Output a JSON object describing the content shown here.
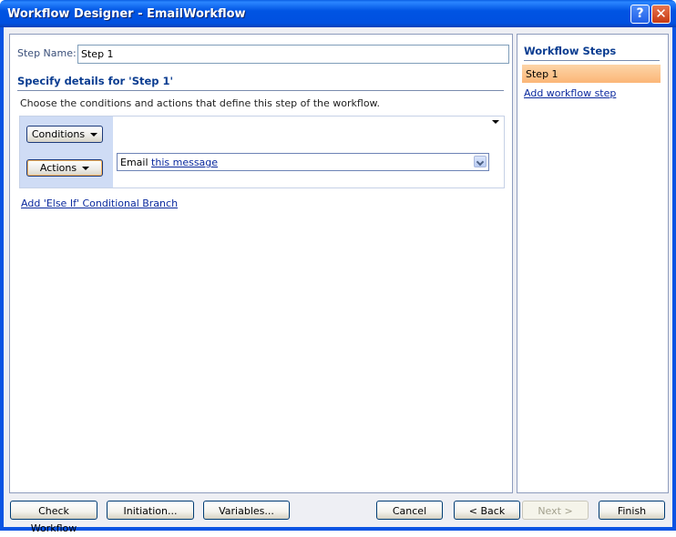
{
  "window": {
    "title": "Workflow Designer - EmailWorkflow",
    "help_symbol": "?",
    "close_symbol": "✕"
  },
  "step_name": {
    "label": "Step Name:",
    "value": "Step 1"
  },
  "details": {
    "title": "Specify details for 'Step 1'",
    "description": "Choose the conditions and actions that define this step of the workflow."
  },
  "branch": {
    "conditions_label": "Conditions",
    "actions_label": "Actions",
    "action": {
      "prefix": "Email",
      "link": "this message"
    }
  },
  "else_if_link": "Add 'Else If' Conditional Branch",
  "workflow_steps": {
    "title": "Workflow Steps",
    "items": [
      "Step 1"
    ],
    "add_link": "Add workflow step"
  },
  "footer": {
    "check_workflow": "Check Workflow",
    "initiation": "Initiation...",
    "variables": "Variables...",
    "cancel": "Cancel",
    "back": "< Back",
    "next": "Next >",
    "finish": "Finish"
  },
  "colors": {
    "titlebar": "#0054e3",
    "panel_header": "#0b3d91",
    "selected_step": "#fbb677",
    "branch_bar": "#cfdcf5"
  }
}
